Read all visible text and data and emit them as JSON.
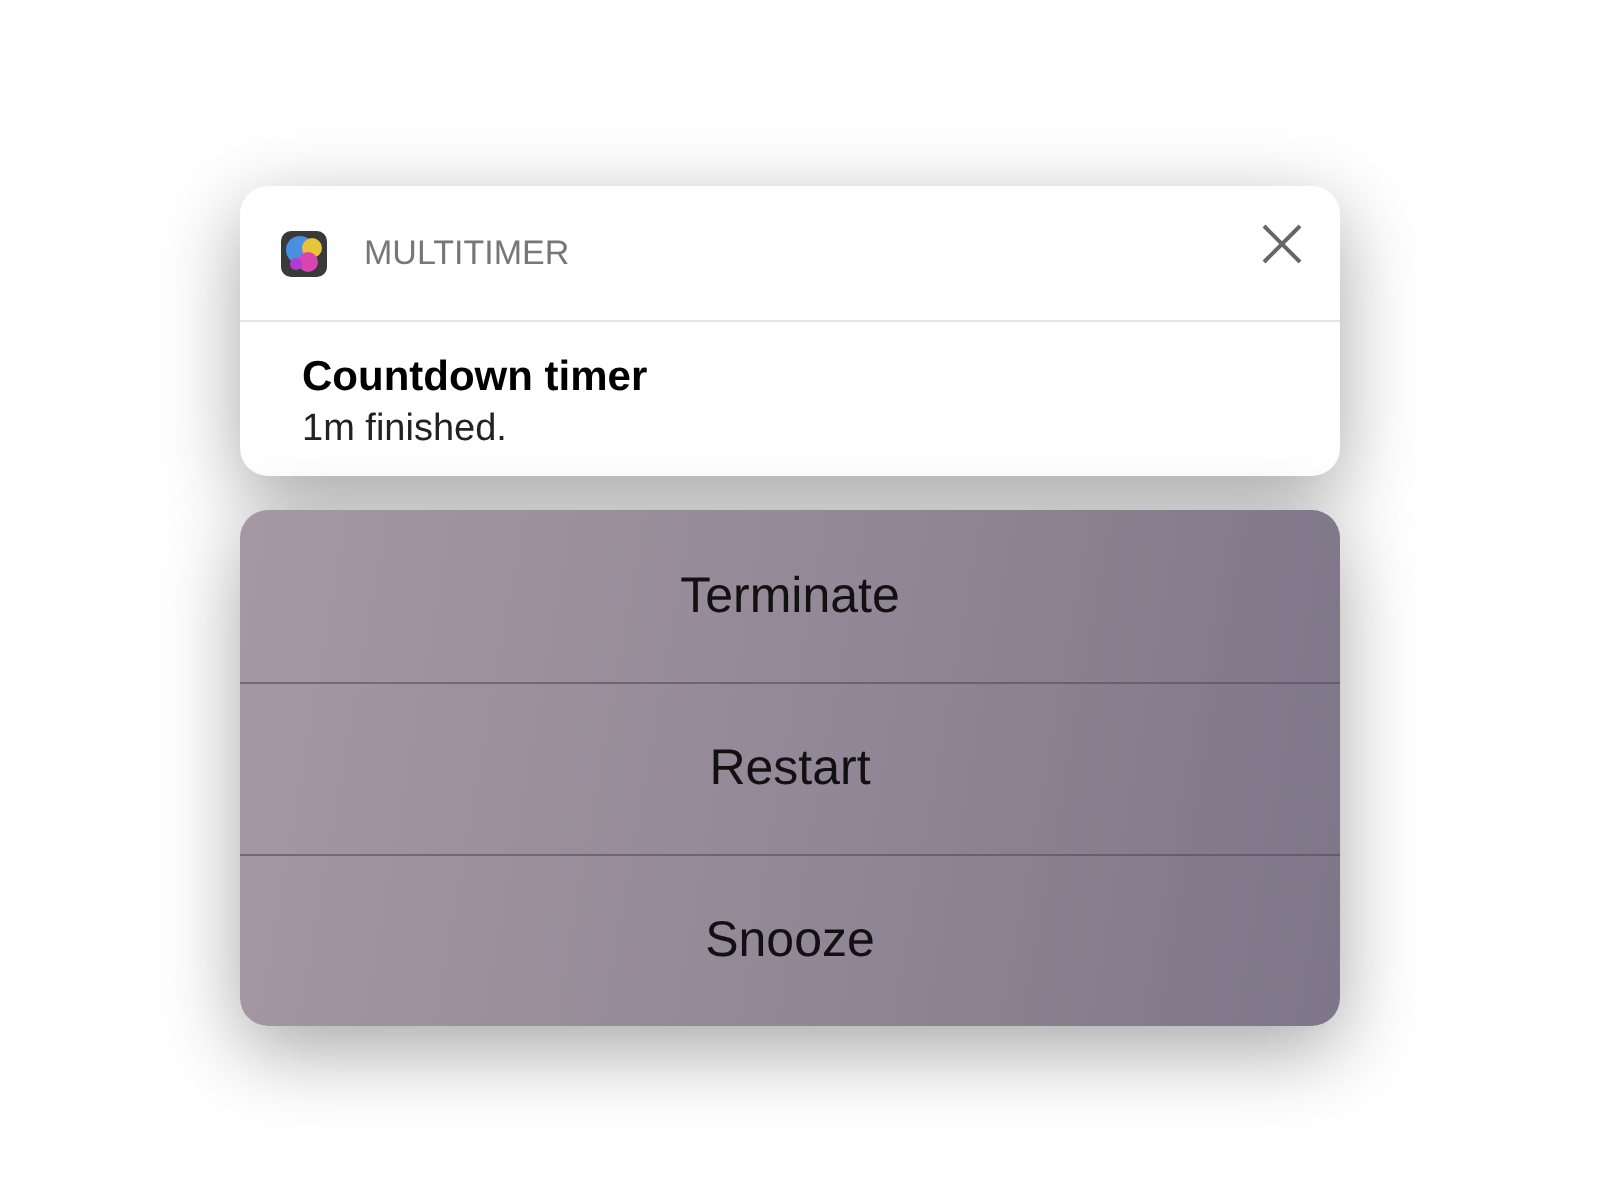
{
  "notification": {
    "app_name": "MULTITIMER",
    "title": "Countdown timer",
    "message": "1m finished."
  },
  "actions": [
    {
      "label": "Terminate"
    },
    {
      "label": "Restart"
    },
    {
      "label": "Snooze"
    }
  ]
}
